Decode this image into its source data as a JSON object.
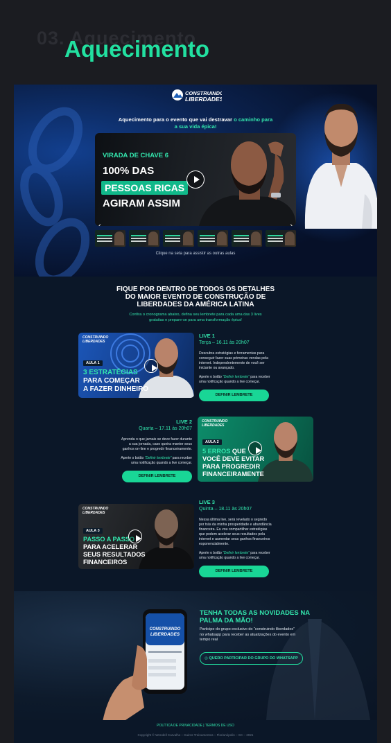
{
  "section_bg_label": "03. Aquecimento",
  "section_title": "Aquecimento",
  "logo": {
    "line1": "CONSTRUINDO",
    "line2": "LIBERDADES"
  },
  "hero": {
    "sub_prefix": "Aquecimento para o evento que vai destravar ",
    "sub_highlight": "o caminho para a sua vida épica!",
    "video": {
      "tag": "VIRADA DE CHAVE 6",
      "line1": "100% DAS",
      "line2": "PESSOAS RICAS",
      "line3": "AGIRAM ASSIM"
    },
    "thumbs_caption": "Clique na seta para assistir as outras aulas",
    "arrow_left": "‹",
    "arrow_right": "›"
  },
  "schedule": {
    "heading": "FIQUE POR DENTRO DE TODOS OS DETALHES DO MAIOR EVENTO DE CONSTRUÇÃO DE LIBERDADES DA AMÉRICA LATINA",
    "subheading": "Confira o cronograma abaixo, defina seu lembrete para cada uma das 3 lives gratuitas e prepare-se para uma transformação épica!"
  },
  "lives": [
    {
      "label": "LIVE 1",
      "when": "Terça – 16.11 às 20h07",
      "desc": "Descubra estratégias e ferramentas para conseguir fazer suas primeiras vendas pela internet. Independentemente de você ser iniciante ou avançado.",
      "note_pre": "Aperte o botão ",
      "note_link": "“Definir lembrete”",
      "note_post": " para receber uma notificação quando a live começar.",
      "button": "DEFINIR LEMBRETE",
      "aula": "AULA 1",
      "t1": "3 ESTRATÉGIAS",
      "t2": "PARA COMEÇAR",
      "t3": "A FAZER DINHEIRO"
    },
    {
      "label": "LIVE 2",
      "when": "Quarta – 17.11 às 20h07",
      "desc": "Aprenda o que jamais se deve fazer durante a sua jornada, caso queira manter seus ganhos on-line e progredir financeiramente.",
      "note_pre": "Aperte o botão ",
      "note_link": "“Definir lembrete”",
      "note_post": " para receber uma notificação quando a live começar.",
      "button": "DEFINIR LEMBRETE",
      "aula": "AULA 2",
      "t1a": "5 ERROS",
      "t1b": " QUE",
      "t2": "VOCÊ DEVE  EVITAR",
      "t3": "PARA PROGREDIR",
      "t4": "FINANCEIRAMENTE"
    },
    {
      "label": "LIVE 3",
      "when": "Quinta – 18.11 às 20h07",
      "desc": "Nessa última live, será revelado o segredo por trás da minha prosperidade e abundância financeira. Eu vou compartilhar estratégias que podem acelerar seus resultados pela internet e aumentar seus ganhos financeiros exponencialmente.",
      "note_pre": "Aperte o botão ",
      "note_link": "“Definir lembrete”",
      "note_post": " para receber uma notificação quando a live começar.",
      "button": "DEFINIR LEMBRETE",
      "aula": "AULA 3",
      "t1": "PASSO A PASSO",
      "t2": "PARA ACELERAR",
      "t3": "SEUS RESULTADOS",
      "t4": "FINANCEIROS"
    }
  ],
  "whatsapp": {
    "title": "TENHA TODAS AS NOVIDADES NA PALMA DA MÃO!",
    "desc": "Participe do grupo exclusivo do “construindo liberdades” no whatsapp para receber as atualizações do evento em tempo real",
    "button": "QUERO PARTICIPAR DO GRUPO DO WHATSAPP"
  },
  "footer": {
    "privacy": "POLÍTICA DE PRIVACIDADE",
    "sep": " | ",
    "terms": "TERMOS DE USO",
    "copyright": "Copyright © Wendell Carvalho – Kairos Treinamentos – Florianópolis – SC – 2021"
  },
  "colors": {
    "accent": "#22e0a0",
    "bg_dark": "#0b1728",
    "page_bg": "#1b1c21"
  }
}
